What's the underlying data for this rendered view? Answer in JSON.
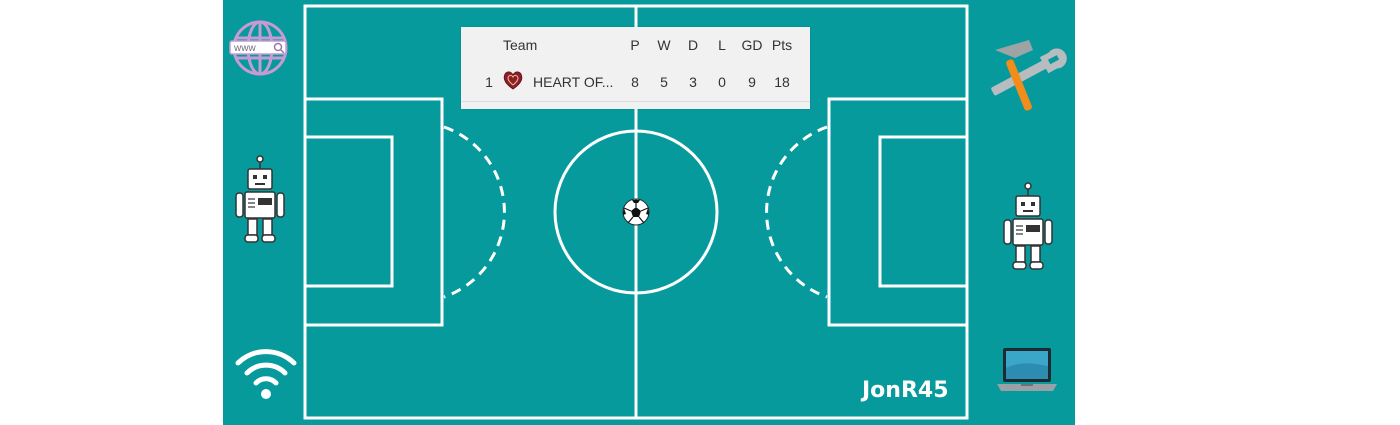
{
  "theme": {
    "background": "#079a9d",
    "lines": "#ffffff",
    "accent_orange": "#f28c1b"
  },
  "table": {
    "columns": {
      "team": "Team",
      "p": "P",
      "w": "W",
      "d": "D",
      "l": "L",
      "gd": "GD",
      "pts": "Pts"
    },
    "rows": [
      {
        "pos": "1",
        "team": "HEART OF...",
        "p": "8",
        "w": "5",
        "d": "3",
        "l": "0",
        "gd": "9",
        "pts": "18"
      }
    ]
  },
  "signature": "JonR45",
  "browser_icon": {
    "address_text": "www"
  },
  "icons": {
    "left": [
      "www-globe-icon",
      "robot-icon",
      "wifi-icon"
    ],
    "right": [
      "hammer-wrench-icon",
      "robot-icon",
      "laptop-icon"
    ],
    "center": "football-icon",
    "crest": "heart-of-midlothian-crest-icon"
  }
}
